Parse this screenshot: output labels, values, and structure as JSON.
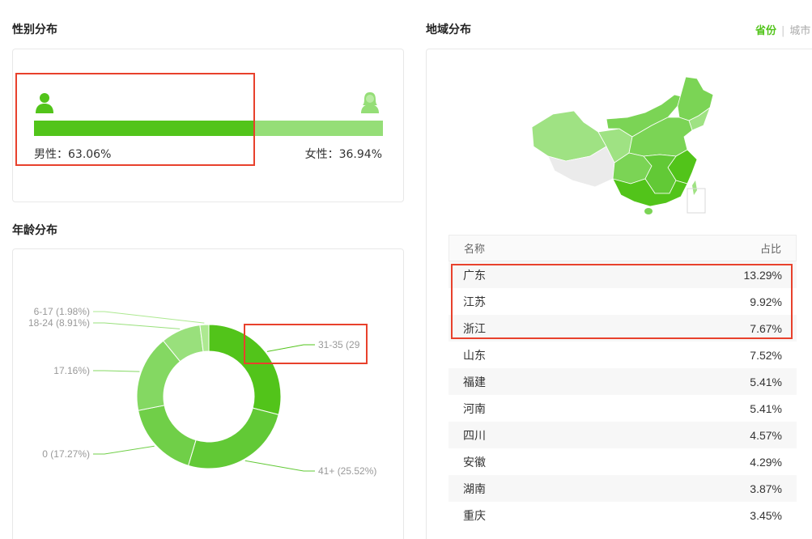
{
  "gender": {
    "title": "性别分布",
    "male_label": "男性：",
    "male_value": "63.06%",
    "male_pct": 63.06,
    "female_label": "女性：",
    "female_value": "36.94%",
    "icons": [
      "male-user-icon",
      "female-user-icon"
    ]
  },
  "age": {
    "title": "年龄分布"
  },
  "chart_data": {
    "type": "pie",
    "categories": [
      "31-35",
      "41+",
      "0",
      "",
      "18-24",
      "6-17"
    ],
    "values": [
      29,
      25.52,
      17.27,
      17.16,
      8.91,
      1.98
    ],
    "labels": [
      "31-35 (29",
      "41+ (25.52%)",
      "0 (17.27%)",
      "17.16%)",
      "18-24 (8.91%)",
      "6-17 (1.98%)"
    ],
    "colors": [
      "#52c41a",
      "#62c936",
      "#70cf48",
      "#84d862",
      "#99e07c",
      "#ade991"
    ],
    "donut": true
  },
  "region": {
    "title": "地域分布",
    "tab_province": "省份",
    "tab_separator": "|",
    "tab_city": "城市",
    "col_name": "名称",
    "col_ratio": "占比",
    "rows": [
      {
        "name": "广东",
        "value": "13.29%"
      },
      {
        "name": "江苏",
        "value": "9.92%"
      },
      {
        "name": "浙江",
        "value": "7.67%"
      },
      {
        "name": "山东",
        "value": "7.52%"
      },
      {
        "name": "福建",
        "value": "5.41%"
      },
      {
        "name": "河南",
        "value": "5.41%"
      },
      {
        "name": "四川",
        "value": "4.57%"
      },
      {
        "name": "安徽",
        "value": "4.29%"
      },
      {
        "name": "湖南",
        "value": "3.87%"
      },
      {
        "name": "重庆",
        "value": "3.45%"
      }
    ],
    "map_colors": {
      "dark": "#52c41a",
      "mid": "#7bd455",
      "light": "#9fe283",
      "none": "#ebebeb"
    }
  }
}
